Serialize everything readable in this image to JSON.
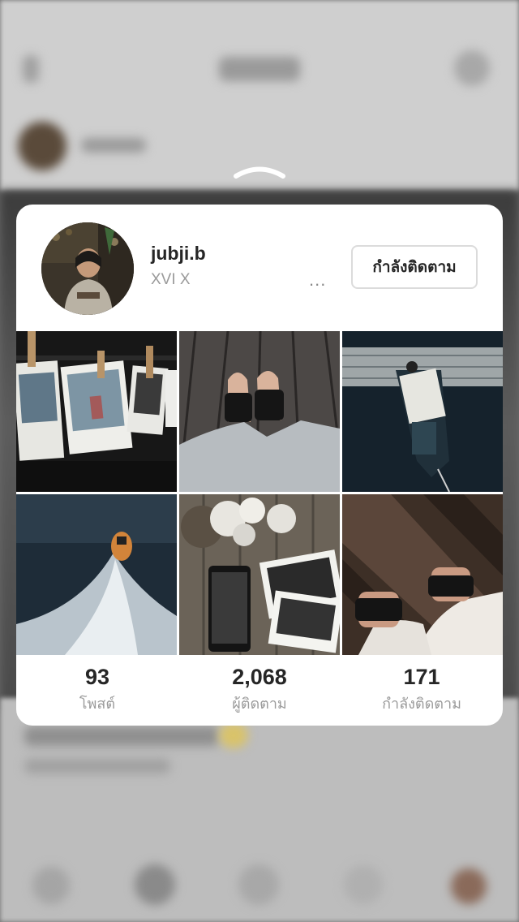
{
  "profile": {
    "username": "jubji.b",
    "full_name": "XVI X",
    "more_label": "...",
    "follow_button_label": "กำลังติดตาม"
  },
  "posts": [
    {
      "name": "post-photos-clothesline"
    },
    {
      "name": "post-sandals-boardwalk"
    },
    {
      "name": "post-boat-aerial"
    },
    {
      "name": "post-speedboat-wake"
    },
    {
      "name": "post-flowers-phone-photos"
    },
    {
      "name": "post-sandals-planks"
    }
  ],
  "stats": [
    {
      "value": "93",
      "label": "โพสต์"
    },
    {
      "value": "2,068",
      "label": "ผู้ติดตาม"
    },
    {
      "value": "171",
      "label": "กำลังติดตาม"
    }
  ],
  "colors": {
    "card_background": "#ffffff",
    "primary_text": "#262626",
    "secondary_text": "#9a9a9a",
    "button_border": "#dbdbdb"
  }
}
